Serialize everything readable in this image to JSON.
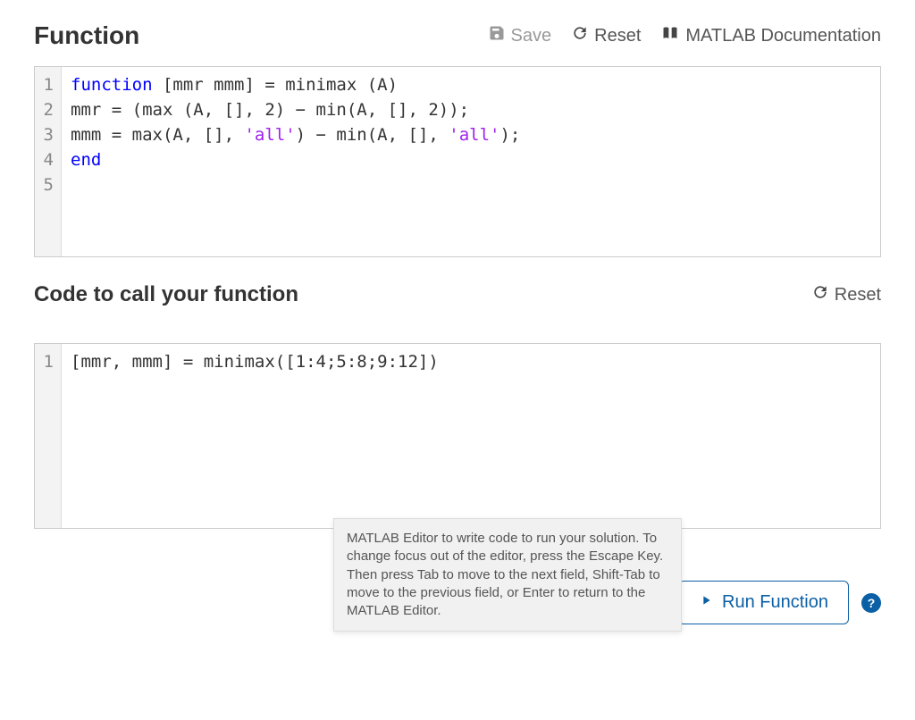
{
  "section1": {
    "title": "Function",
    "actions": {
      "save": "Save",
      "reset": "Reset",
      "docs": "MATLAB Documentation"
    }
  },
  "func_editor": {
    "line_numbers": [
      "1",
      "2",
      "3",
      "4",
      "5"
    ],
    "code": [
      {
        "tokens": [
          {
            "t": "function",
            "c": "kw"
          },
          {
            "t": " [mmr mmm] = minimax (A)",
            "c": ""
          }
        ]
      },
      {
        "tokens": [
          {
            "t": "mmr = (max (A, [], 2) − min(A, [], 2));",
            "c": ""
          }
        ]
      },
      {
        "tokens": [
          {
            "t": "mmm = max(A, [], ",
            "c": ""
          },
          {
            "t": "'all'",
            "c": "str"
          },
          {
            "t": ") − min(A, [], ",
            "c": ""
          },
          {
            "t": "'all'",
            "c": "str"
          },
          {
            "t": ");",
            "c": ""
          }
        ]
      },
      {
        "tokens": [
          {
            "t": "end",
            "c": "kw"
          }
        ]
      },
      {
        "tokens": [
          {
            "t": "",
            "c": ""
          }
        ]
      }
    ]
  },
  "section2": {
    "title": "Code to call your function",
    "reset": "Reset"
  },
  "call_editor": {
    "line_numbers": [
      "1"
    ],
    "code": [
      {
        "tokens": [
          {
            "t": "[mmr, mmm] = minimax([1:4;5:8;9:12])",
            "c": ""
          }
        ]
      }
    ]
  },
  "tooltip": "MATLAB Editor to write code to run your solution. To change focus out of the editor, press the Escape Key. Then press Tab to move to the next field, Shift-Tab to move to the previous field, or Enter to return to the MATLAB Editor.",
  "run_label": "Run Function",
  "help": "?"
}
